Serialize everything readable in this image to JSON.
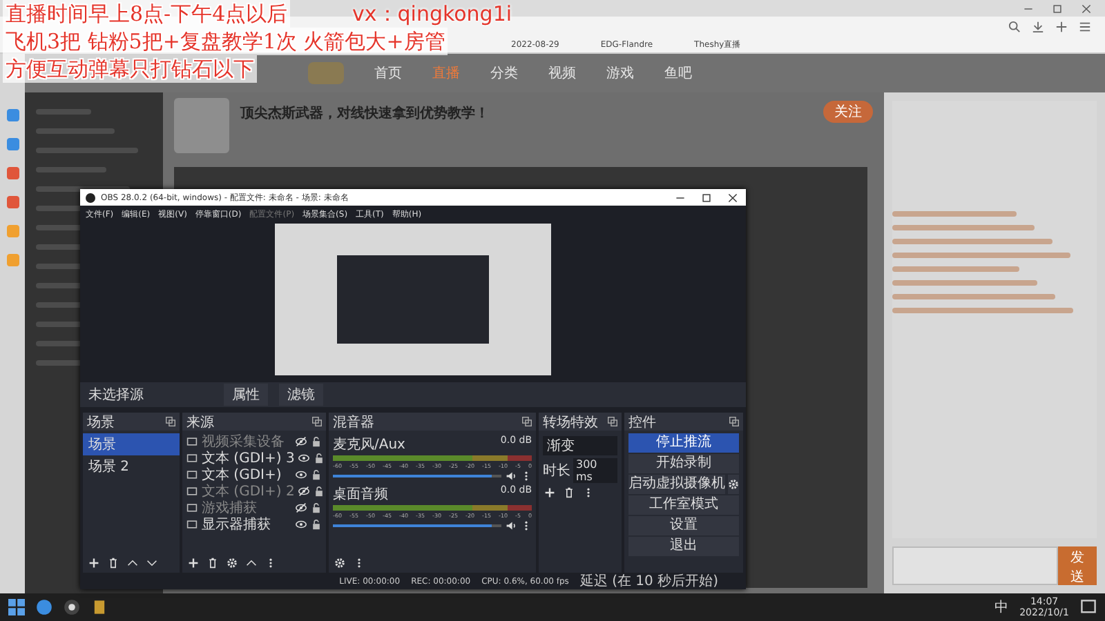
{
  "overlay": {
    "lines": [
      "直播时间早上8点-下午4点以后",
      "飞机3把 钻粉5把+复盘教学1次 火箭包大+房管",
      "方便互动弹幕只打钻石以下"
    ],
    "contact": "vx：qingkong1i"
  },
  "browser": {
    "bookmarks": [
      "2022-08-29",
      "EDG-Flandre",
      "Theshy直播"
    ],
    "nav": [
      {
        "label": "首页",
        "selected": false
      },
      {
        "label": "直播",
        "selected": true
      },
      {
        "label": "分类",
        "selected": false
      },
      {
        "label": "视频",
        "selected": false
      },
      {
        "label": "游戏",
        "selected": false
      },
      {
        "label": "鱼吧",
        "selected": false
      }
    ],
    "stream_title": "顶尖杰斯武器，对线快速拿到优势教学！",
    "follow": "关注",
    "send": "发送"
  },
  "obs": {
    "title": "OBS 28.0.2 (64-bit, windows) - 配置文件: 未命名 - 场景: 未命名",
    "menu": [
      {
        "label": "文件(F)",
        "disabled": false
      },
      {
        "label": "编辑(E)",
        "disabled": false
      },
      {
        "label": "视图(V)",
        "disabled": false
      },
      {
        "label": "停靠窗口(D)",
        "disabled": false
      },
      {
        "label": "配置文件(P)",
        "disabled": true
      },
      {
        "label": "场景集合(S)",
        "disabled": false
      },
      {
        "label": "工具(T)",
        "disabled": false
      },
      {
        "label": "帮助(H)",
        "disabled": false
      }
    ],
    "no_source": "未选择源",
    "properties": "属性",
    "filters": "滤镜",
    "scenes": {
      "title": "场景",
      "items": [
        {
          "label": "场景",
          "selected": true
        },
        {
          "label": "场景 2",
          "selected": false
        }
      ]
    },
    "sources": {
      "title": "来源",
      "items": [
        {
          "name": "视频采集设备",
          "visible": false
        },
        {
          "name": "文本 (GDI+) 3",
          "visible": true
        },
        {
          "name": "文本 (GDI+)",
          "visible": true
        },
        {
          "name": "文本 (GDI+) 2",
          "visible": false
        },
        {
          "name": "游戏捕获",
          "visible": false
        },
        {
          "name": "显示器捕获",
          "visible": true
        }
      ]
    },
    "mixer": {
      "title": "混音器",
      "channels": [
        {
          "name": "麦克风/Aux",
          "reading": "0.0 dB",
          "level": 0.94,
          "scale": [
            "-60",
            "-55",
            "-50",
            "-45",
            "-40",
            "-35",
            "-30",
            "-25",
            "-20",
            "-15",
            "-10",
            "-5",
            "0"
          ]
        },
        {
          "name": "桌面音频",
          "reading": "0.0 dB",
          "level": 0.94,
          "scale": [
            "-60",
            "-55",
            "-50",
            "-45",
            "-40",
            "-35",
            "-30",
            "-25",
            "-20",
            "-15",
            "-10",
            "-5",
            "0"
          ]
        }
      ]
    },
    "transitions": {
      "title": "转场特效",
      "type": "渐变",
      "duration_label": "时长",
      "duration": "300 ms"
    },
    "controls": {
      "title": "控件",
      "buttons": [
        {
          "label": "停止推流",
          "kind": "primary"
        },
        {
          "label": "开始录制",
          "kind": "plain"
        },
        {
          "label": "启动虚拟摄像机",
          "kind": "gear"
        },
        {
          "label": "工作室模式",
          "kind": "plain"
        },
        {
          "label": "设置",
          "kind": "plain"
        },
        {
          "label": "退出",
          "kind": "plain"
        }
      ]
    },
    "status": {
      "live": "LIVE: 00:00:00",
      "rec": "REC: 00:00:00",
      "cpu": "CPU: 0.6%, 60.00 fps",
      "delay": "延迟 (在 10 秒后开始)"
    }
  },
  "taskbar": {
    "ime": "中",
    "time": "14:07",
    "date": "2022/10/1"
  }
}
